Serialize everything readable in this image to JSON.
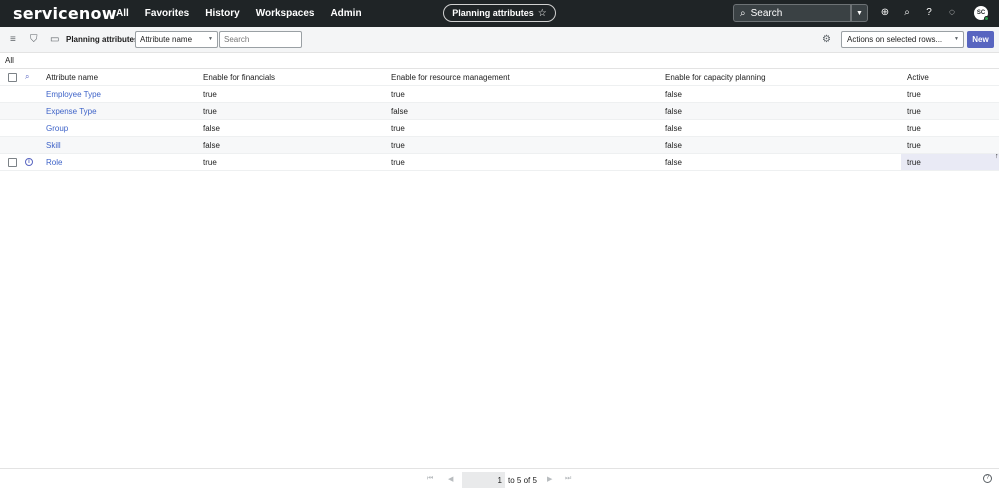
{
  "topnav": {
    "logo": "servicenow",
    "links": [
      "All",
      "Favorites",
      "History",
      "Workspaces",
      "Admin"
    ],
    "page_pill": "Planning attributes",
    "search_placeholder": "Search",
    "avatar_initials": "SC"
  },
  "toolbar": {
    "title": "Planning attributes",
    "field_select": "Attribute name",
    "search_placeholder": "Search",
    "actions_select": "Actions on selected rows...",
    "new_button": "New"
  },
  "breadcrumb": "All",
  "table": {
    "columns": [
      "Attribute name",
      "Enable for financials",
      "Enable for resource management",
      "Enable for capacity planning",
      "Active"
    ],
    "rows": [
      {
        "name": "Employee Type",
        "financials": "true",
        "resource": "true",
        "capacity": "false",
        "active": "true"
      },
      {
        "name": "Expense Type",
        "financials": "true",
        "resource": "false",
        "capacity": "false",
        "active": "true"
      },
      {
        "name": "Group",
        "financials": "false",
        "resource": "true",
        "capacity": "false",
        "active": "true"
      },
      {
        "name": "Skill",
        "financials": "false",
        "resource": "true",
        "capacity": "false",
        "active": "true"
      },
      {
        "name": "Role",
        "financials": "true",
        "resource": "true",
        "capacity": "false",
        "active": "true"
      }
    ]
  },
  "pager": {
    "page_value": "1",
    "range_text": "to 5 of 5"
  },
  "colors": {
    "nav_bg": "#1f2426",
    "accent": "#5865c0",
    "link": "#3e63c8"
  }
}
